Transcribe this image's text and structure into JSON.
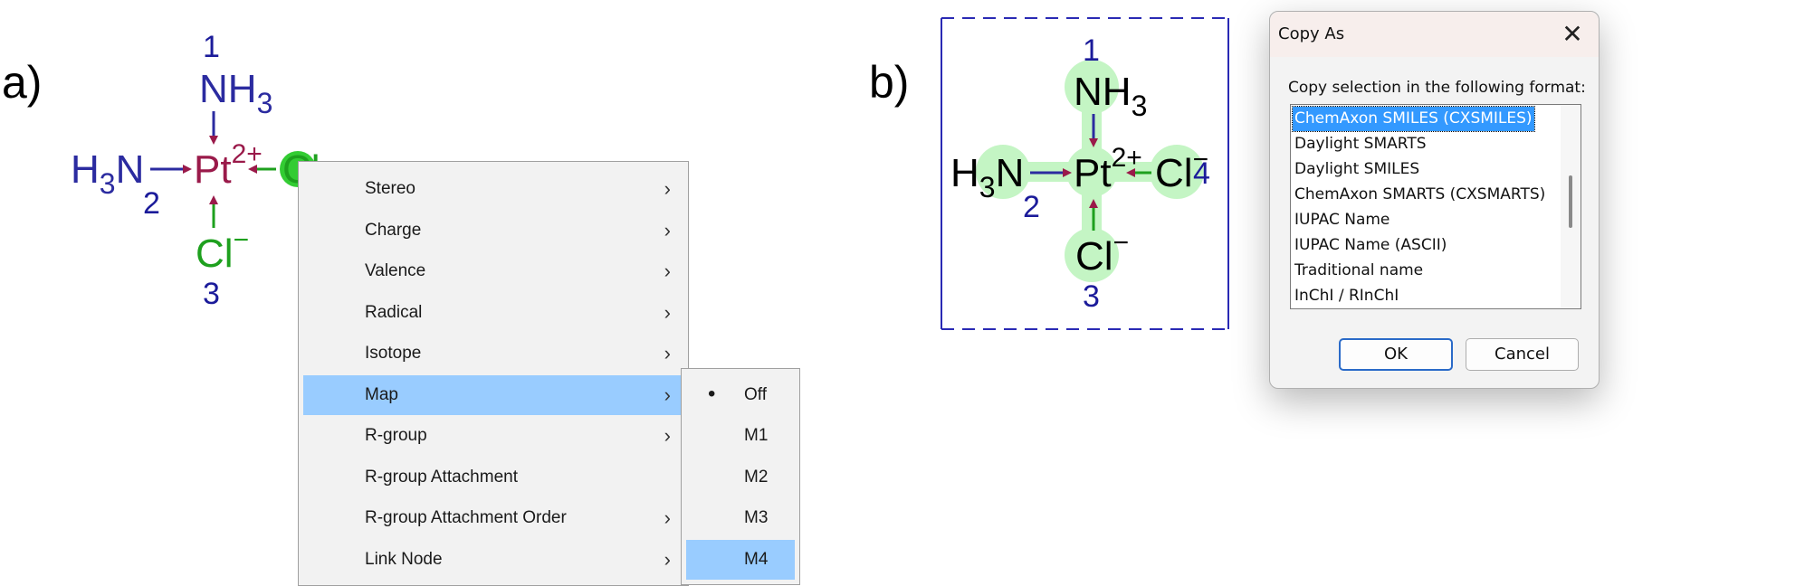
{
  "panel_a": {
    "label": "a)",
    "structure": {
      "center_atom": "Pt",
      "center_charge": "2+",
      "top_ligand": {
        "symbol": "NH",
        "subscript": "3",
        "map": "1"
      },
      "left_ligand": {
        "prefix": "H",
        "subscript": "3",
        "symbol": "N",
        "map": "2"
      },
      "bottom_ligand": {
        "symbol": "Cl",
        "charge": "−",
        "map": "3"
      },
      "right_ligand": {
        "symbol": "Cl",
        "charge": "−"
      }
    }
  },
  "context_menu": {
    "items": [
      {
        "label": "Stereo",
        "has_submenu": true
      },
      {
        "label": "Charge",
        "has_submenu": true
      },
      {
        "label": "Valence",
        "has_submenu": true
      },
      {
        "label": "Radical",
        "has_submenu": true
      },
      {
        "label": "Isotope",
        "has_submenu": true
      },
      {
        "label": "Map",
        "has_submenu": true,
        "highlighted": true
      },
      {
        "label": "R-group",
        "has_submenu": true
      },
      {
        "label": "R-group Attachment",
        "has_submenu": false
      },
      {
        "label": "R-group Attachment Order",
        "has_submenu": true
      },
      {
        "label": "Link Node",
        "has_submenu": true
      }
    ],
    "chevron": "›"
  },
  "map_submenu": {
    "items": [
      {
        "label": "Off",
        "checked": true
      },
      {
        "label": "M1"
      },
      {
        "label": "M2"
      },
      {
        "label": "M3"
      },
      {
        "label": "M4",
        "highlighted": true
      }
    ],
    "bullet": "•"
  },
  "panel_b": {
    "label": "b)",
    "structure": {
      "center_atom": "Pt",
      "center_charge": "2+",
      "top_ligand": {
        "symbol": "NH",
        "subscript": "3",
        "map": "1"
      },
      "left_ligand": {
        "prefix": "H",
        "subscript": "3",
        "symbol": "N",
        "map": "2"
      },
      "bottom_ligand": {
        "symbol": "Cl",
        "charge": "−",
        "map": "3"
      },
      "right_ligand": {
        "symbol": "Cl",
        "charge": "−",
        "map": "4"
      }
    }
  },
  "dialog": {
    "title": "Copy As",
    "close_glyph": "✕",
    "prompt": "Copy selection in the following format:",
    "formats": [
      "ChemAxon SMILES (CXSMILES)",
      "Daylight SMARTS",
      "Daylight SMILES",
      "ChemAxon SMARTS (CXSMARTS)",
      "IUPAC Name",
      "IUPAC Name (ASCII)",
      "Traditional name",
      "InChI / RInChI"
    ],
    "selected_format": "ChemAxon SMILES (CXSMILES)",
    "ok_label": "OK",
    "cancel_label": "Cancel"
  },
  "colors": {
    "nitrogen": "#2b2ba0",
    "platinum": "#9a1a4a",
    "chlorine": "#1ea01e",
    "map_number": "#1b1b9a",
    "selection_frame": "#2a2ab4",
    "highlight_halo": "#c4f5c4",
    "menu_highlight": "#99ccff",
    "list_selection": "#3399ff"
  }
}
